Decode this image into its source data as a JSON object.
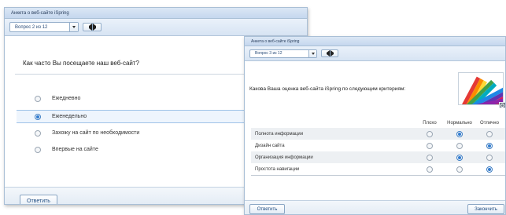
{
  "window1": {
    "title": "Анкета о веб-сайте iSpring",
    "question_select": "Вопрос 2 из 12",
    "question": "Как часто Вы посещаете наш веб-сайт?",
    "options": [
      {
        "label": "Ежедневно",
        "selected": false
      },
      {
        "label": "Еженедельно",
        "selected": true
      },
      {
        "label": "Захожу на сайт по необходимости",
        "selected": false
      },
      {
        "label": "Впервые на сайте",
        "selected": false
      }
    ],
    "answer_button": "Ответить"
  },
  "window2": {
    "title": "Анкета о веб-сайте iSpring",
    "question_select": "Вопрос 3 из 12",
    "question": "Какова Ваша оценка веб-сайта iSpring по следующим критериям:",
    "columns": [
      "Плохо",
      "Нормально",
      "Отлично"
    ],
    "rows": [
      {
        "label": "Полнота информации",
        "selected": 1
      },
      {
        "label": "Дизайн сайта",
        "selected": 2
      },
      {
        "label": "Организация информации",
        "selected": 1
      },
      {
        "label": "Простота навигации",
        "selected": 2
      }
    ],
    "answer_button": "Ответить",
    "finish_button": "Закончить"
  }
}
